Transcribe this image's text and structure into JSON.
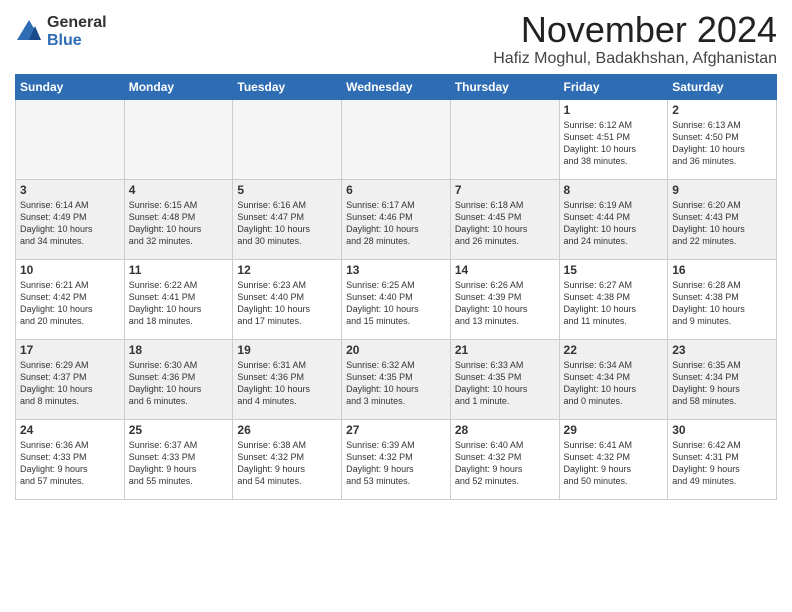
{
  "logo": {
    "general": "General",
    "blue": "Blue"
  },
  "title": "November 2024",
  "location": "Hafiz Moghul, Badakhshan, Afghanistan",
  "days_of_week": [
    "Sunday",
    "Monday",
    "Tuesday",
    "Wednesday",
    "Thursday",
    "Friday",
    "Saturday"
  ],
  "weeks": [
    [
      {
        "day": "",
        "info": ""
      },
      {
        "day": "",
        "info": ""
      },
      {
        "day": "",
        "info": ""
      },
      {
        "day": "",
        "info": ""
      },
      {
        "day": "",
        "info": ""
      },
      {
        "day": "1",
        "info": "Sunrise: 6:12 AM\nSunset: 4:51 PM\nDaylight: 10 hours\nand 38 minutes."
      },
      {
        "day": "2",
        "info": "Sunrise: 6:13 AM\nSunset: 4:50 PM\nDaylight: 10 hours\nand 36 minutes."
      }
    ],
    [
      {
        "day": "3",
        "info": "Sunrise: 6:14 AM\nSunset: 4:49 PM\nDaylight: 10 hours\nand 34 minutes."
      },
      {
        "day": "4",
        "info": "Sunrise: 6:15 AM\nSunset: 4:48 PM\nDaylight: 10 hours\nand 32 minutes."
      },
      {
        "day": "5",
        "info": "Sunrise: 6:16 AM\nSunset: 4:47 PM\nDaylight: 10 hours\nand 30 minutes."
      },
      {
        "day": "6",
        "info": "Sunrise: 6:17 AM\nSunset: 4:46 PM\nDaylight: 10 hours\nand 28 minutes."
      },
      {
        "day": "7",
        "info": "Sunrise: 6:18 AM\nSunset: 4:45 PM\nDaylight: 10 hours\nand 26 minutes."
      },
      {
        "day": "8",
        "info": "Sunrise: 6:19 AM\nSunset: 4:44 PM\nDaylight: 10 hours\nand 24 minutes."
      },
      {
        "day": "9",
        "info": "Sunrise: 6:20 AM\nSunset: 4:43 PM\nDaylight: 10 hours\nand 22 minutes."
      }
    ],
    [
      {
        "day": "10",
        "info": "Sunrise: 6:21 AM\nSunset: 4:42 PM\nDaylight: 10 hours\nand 20 minutes."
      },
      {
        "day": "11",
        "info": "Sunrise: 6:22 AM\nSunset: 4:41 PM\nDaylight: 10 hours\nand 18 minutes."
      },
      {
        "day": "12",
        "info": "Sunrise: 6:23 AM\nSunset: 4:40 PM\nDaylight: 10 hours\nand 17 minutes."
      },
      {
        "day": "13",
        "info": "Sunrise: 6:25 AM\nSunset: 4:40 PM\nDaylight: 10 hours\nand 15 minutes."
      },
      {
        "day": "14",
        "info": "Sunrise: 6:26 AM\nSunset: 4:39 PM\nDaylight: 10 hours\nand 13 minutes."
      },
      {
        "day": "15",
        "info": "Sunrise: 6:27 AM\nSunset: 4:38 PM\nDaylight: 10 hours\nand 11 minutes."
      },
      {
        "day": "16",
        "info": "Sunrise: 6:28 AM\nSunset: 4:38 PM\nDaylight: 10 hours\nand 9 minutes."
      }
    ],
    [
      {
        "day": "17",
        "info": "Sunrise: 6:29 AM\nSunset: 4:37 PM\nDaylight: 10 hours\nand 8 minutes."
      },
      {
        "day": "18",
        "info": "Sunrise: 6:30 AM\nSunset: 4:36 PM\nDaylight: 10 hours\nand 6 minutes."
      },
      {
        "day": "19",
        "info": "Sunrise: 6:31 AM\nSunset: 4:36 PM\nDaylight: 10 hours\nand 4 minutes."
      },
      {
        "day": "20",
        "info": "Sunrise: 6:32 AM\nSunset: 4:35 PM\nDaylight: 10 hours\nand 3 minutes."
      },
      {
        "day": "21",
        "info": "Sunrise: 6:33 AM\nSunset: 4:35 PM\nDaylight: 10 hours\nand 1 minute."
      },
      {
        "day": "22",
        "info": "Sunrise: 6:34 AM\nSunset: 4:34 PM\nDaylight: 10 hours\nand 0 minutes."
      },
      {
        "day": "23",
        "info": "Sunrise: 6:35 AM\nSunset: 4:34 PM\nDaylight: 9 hours\nand 58 minutes."
      }
    ],
    [
      {
        "day": "24",
        "info": "Sunrise: 6:36 AM\nSunset: 4:33 PM\nDaylight: 9 hours\nand 57 minutes."
      },
      {
        "day": "25",
        "info": "Sunrise: 6:37 AM\nSunset: 4:33 PM\nDaylight: 9 hours\nand 55 minutes."
      },
      {
        "day": "26",
        "info": "Sunrise: 6:38 AM\nSunset: 4:32 PM\nDaylight: 9 hours\nand 54 minutes."
      },
      {
        "day": "27",
        "info": "Sunrise: 6:39 AM\nSunset: 4:32 PM\nDaylight: 9 hours\nand 53 minutes."
      },
      {
        "day": "28",
        "info": "Sunrise: 6:40 AM\nSunset: 4:32 PM\nDaylight: 9 hours\nand 52 minutes."
      },
      {
        "day": "29",
        "info": "Sunrise: 6:41 AM\nSunset: 4:32 PM\nDaylight: 9 hours\nand 50 minutes."
      },
      {
        "day": "30",
        "info": "Sunrise: 6:42 AM\nSunset: 4:31 PM\nDaylight: 9 hours\nand 49 minutes."
      }
    ]
  ]
}
